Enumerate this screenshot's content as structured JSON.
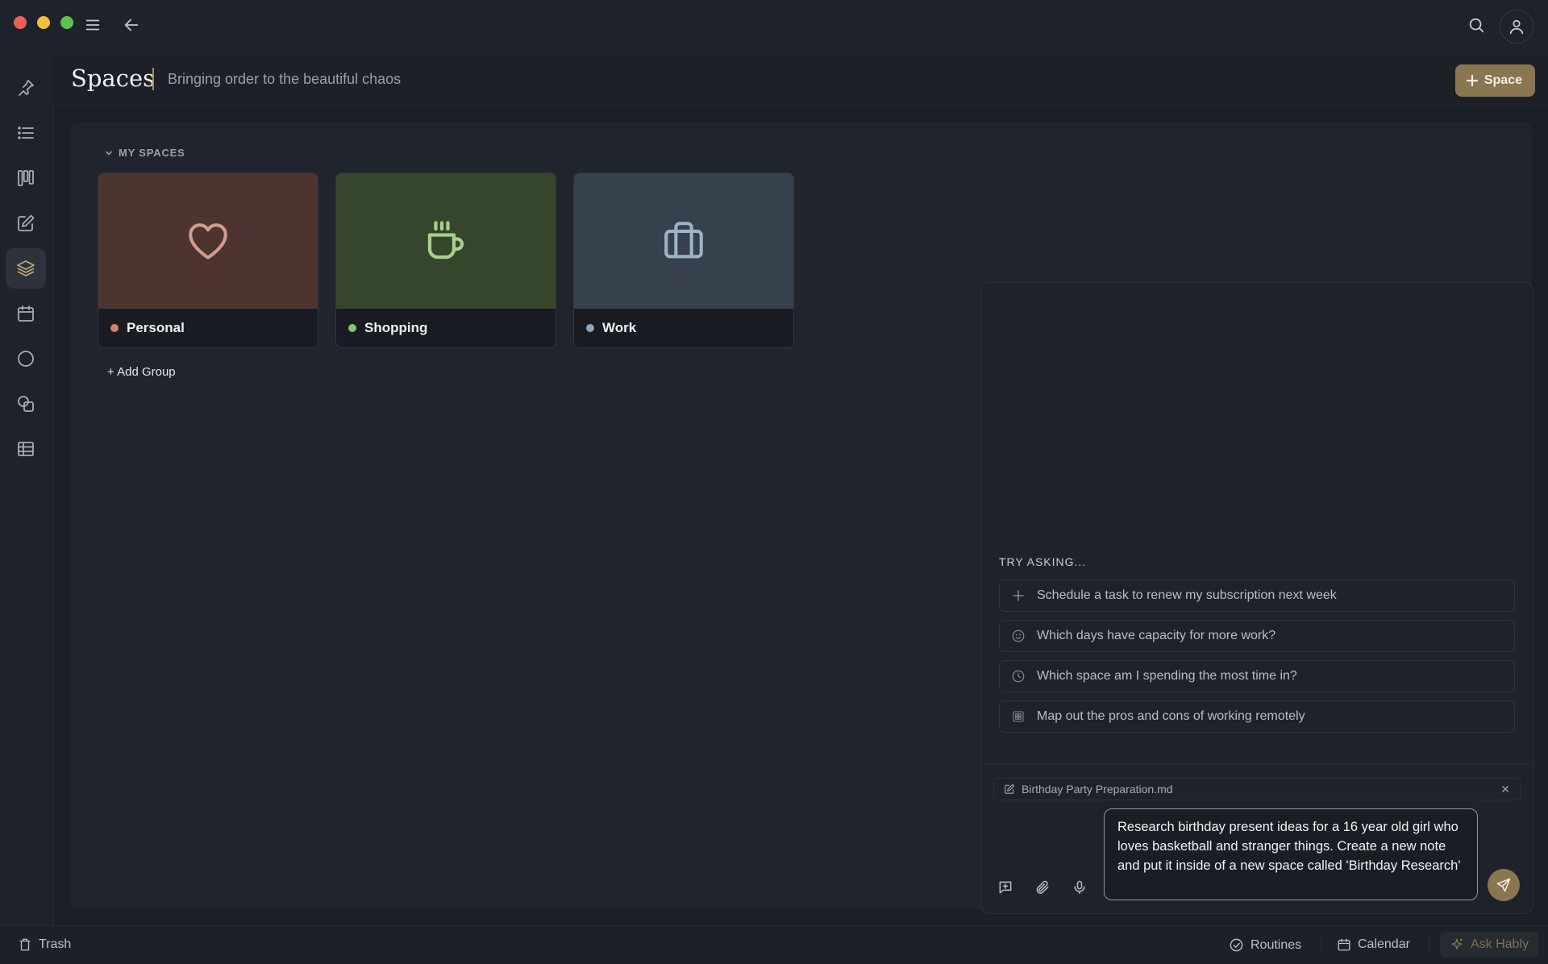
{
  "window": {
    "traffic_lights": {
      "close": "#ec5f57",
      "minimize": "#f2bd3b",
      "maximize": "#5fc24f"
    }
  },
  "icons": {
    "menu": "menu-icon",
    "back": "arrow-left-icon",
    "search": "search-icon",
    "account": "user-icon"
  },
  "sidebar": {
    "items": [
      {
        "icon": "pin-icon"
      },
      {
        "icon": "list-icon"
      },
      {
        "icon": "kanban-icon"
      },
      {
        "icon": "edit-icon"
      },
      {
        "icon": "layers-icon",
        "active": true
      },
      {
        "icon": "calendar-icon"
      },
      {
        "icon": "circle-icon"
      },
      {
        "icon": "shapes-icon"
      },
      {
        "icon": "table-icon"
      }
    ]
  },
  "header": {
    "title": "Spaces",
    "subtitle": "Bringing order to the beautiful chaos",
    "new_space_label": "Space"
  },
  "spaces": {
    "group_label": "MY SPACES",
    "items": [
      {
        "name": "Personal",
        "icon": "heart-icon",
        "dot_color": "#d7806a",
        "cover_color": "#4d3431",
        "icon_color": "#d39b8e"
      },
      {
        "name": "Shopping",
        "icon": "coffee-cup-icon",
        "dot_color": "#8bc466",
        "cover_color": "#35462d",
        "icon_color": "#a8cf8c"
      },
      {
        "name": "Work",
        "icon": "briefcase-icon",
        "dot_color": "#8fa7bd",
        "cover_color": "#36414d",
        "icon_color": "#9db3c8"
      }
    ],
    "add_group_label": "+ Add Group"
  },
  "assistant": {
    "try_asking_label": "TRY ASKING...",
    "suggestions": [
      {
        "text": "Schedule a task to renew my subscription next week",
        "icon": "plus-icon"
      },
      {
        "text": "Which days have capacity for more work?",
        "icon": "smiley-icon"
      },
      {
        "text": "Which space am I spending the most time in?",
        "icon": "clock-icon"
      },
      {
        "text": "Map out the pros and cons of working remotely",
        "icon": "grid-icon"
      }
    ],
    "attachment": "Birthday Party Preparation.md",
    "prompt": "Research birthday present ideas for a 16 year old girl who loves basketball and stranger things. Create a new note and put it inside of a new space called 'Birthday Research'"
  },
  "statusbar": {
    "trash_label": "Trash",
    "routines_label": "Routines",
    "calendar_label": "Calendar",
    "ask_label": "Ask Hably"
  },
  "colors": {
    "accent": "#8a7650",
    "background": "#1b1f26"
  }
}
